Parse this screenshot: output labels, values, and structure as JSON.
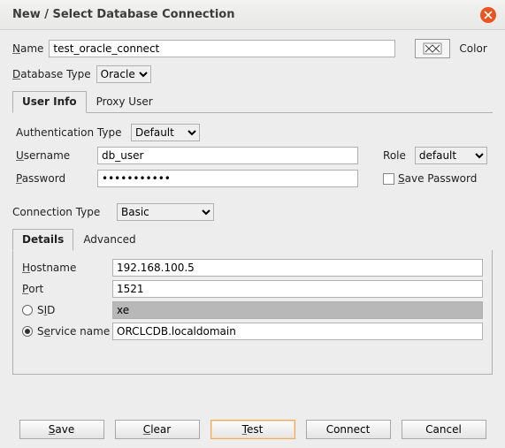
{
  "window": {
    "title": "New / Select Database Connection"
  },
  "form": {
    "name_label_prefix": "N",
    "name_label_rest": "ame",
    "name_value": "test_oracle_connect",
    "color_label": "Color",
    "dbtype_label_prefix": "D",
    "dbtype_label_rest": "atabase Type",
    "dbtype_value": "Oracle"
  },
  "tabs1": {
    "user_info": "User Info",
    "proxy_user": "Proxy User"
  },
  "auth": {
    "type_label": "Authentication Type",
    "type_value": "Default",
    "username_label_prefix": "U",
    "username_label_rest": "sername",
    "username_value": "db_user",
    "password_label_prefix": "P",
    "password_label_rest": "assword",
    "password_value": "•••••••••••",
    "role_label_prefix": "R",
    "role_label_rest": "ole",
    "role_value": "default",
    "save_pwd_prefix": "S",
    "save_pwd_rest": "ave Password"
  },
  "conn": {
    "type_label": "Connection Type",
    "type_value": "Basic"
  },
  "tabs2": {
    "details": "Details",
    "advanced": "Advanced"
  },
  "details": {
    "hostname_label_prefix": "H",
    "hostname_label_rest": "ostname",
    "hostname_value": "192.168.100.5",
    "port_label_prefix": "P",
    "port_label_rest": "ort",
    "port_value": "1521",
    "sid_label_prefix": "I",
    "sid_label_pre": "S",
    "sid_label_rest": "D",
    "sid_value": "xe",
    "service_label_pre": "S",
    "service_label_prefix": "e",
    "service_label_rest": "rvice name",
    "service_value": "ORCLCDB.localdomain"
  },
  "buttons": {
    "save_prefix": "S",
    "save_rest": "ave",
    "clear_prefix": "C",
    "clear_rest": "lear",
    "test_prefix": "T",
    "test_rest": "est",
    "connect": "Connect",
    "cancel": "Cancel"
  }
}
